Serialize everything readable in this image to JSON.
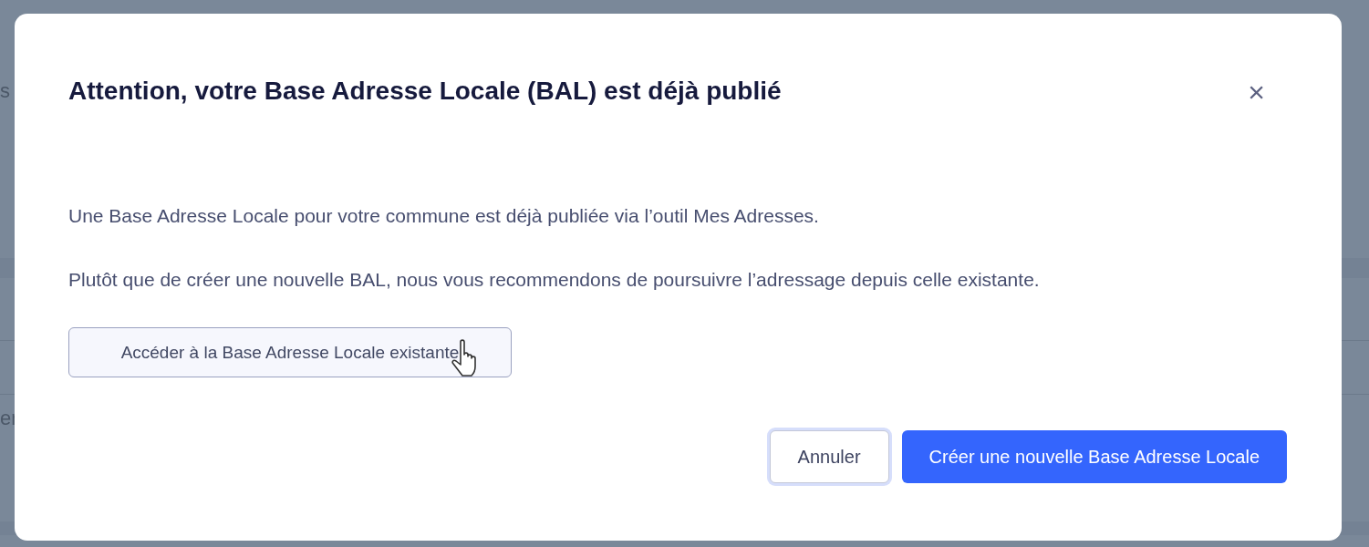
{
  "background": {
    "fragments": [
      "s",
      "er"
    ]
  },
  "dialog": {
    "title": "Attention, votre Base Adresse Locale (BAL) est déjà publié",
    "close": "×",
    "paragraphs": [
      "Une Base Adresse Locale pour votre commune est déjà publiée via l’outil Mes Adresses.",
      "Plutôt que de créer une nouvelle BAL, nous vous recommendons de poursuivre l’adressage depuis celle existante."
    ],
    "link_button": {
      "label": "Accéder à la Base Adresse Locale existante",
      "hovered": true
    },
    "buttons": [
      {
        "label": "Annuler",
        "kind": "secondary",
        "focused": true
      },
      {
        "label": "Créer une nouvelle Base Adresse Locale",
        "kind": "primary",
        "focused": false
      }
    ]
  }
}
